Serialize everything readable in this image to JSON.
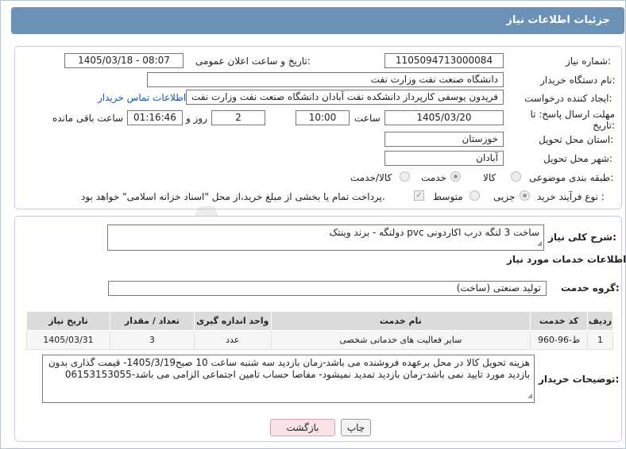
{
  "header": {
    "title": "جزئیات اطلاعات نیاز"
  },
  "form": {
    "need_number_label": "شماره نیاز:",
    "need_number": "1105094713000084",
    "announce_label": "تاریخ و ساعت اعلان عمومی:",
    "announce_value": "1405/03/18 - 08:07",
    "buyer_org_label": "نام دستگاه خریدار:",
    "buyer_org": "دانشگاه صنعت نفت وزارت نفت",
    "creator_label": "ایجاد کننده درخواست:",
    "creator": "فریدون یوسفی کارپرداز دانشکده نفت آبادان دانشگاه صنعت نفت وزارت نفت",
    "contact_link": "اطلاعات تماس خریدار",
    "deadline_label": "مهلت ارسال پاسخ: تا تاریخ:",
    "deadline_date": "1405/03/20",
    "time_label": "ساعت",
    "deadline_time": "10:00",
    "days": "2",
    "days_label": "روز و",
    "remaining_time": "01:16:46",
    "remaining_label": "ساعت باقی مانده",
    "province_label": "استان محل تحویل:",
    "province": "خوزستان",
    "city_label": "شهر محل تحویل:",
    "city": "آبادان",
    "category_label": "طبقه بندی موضوعی:",
    "category_options": [
      "کالا",
      "خدمت",
      "کالا/خدمت"
    ],
    "process_label": "نوع فرآیند خرید :",
    "process_options": [
      "جزیی",
      "متوسط"
    ],
    "treasury_note": "پرداخت تمام یا بخشی از مبلغ خرید،از محل \"اسناد خزانه اسلامی\" خواهد بود."
  },
  "description": {
    "label": "شرح کلی نیاز:",
    "text": "ساخت 3 لنگه  درب اکاردونی pvc دولنگه - برند وینتک"
  },
  "services": {
    "section_title": "اطلاعات خدمات مورد نیاز",
    "group_label": "گروه خدمت:",
    "group_value": "تولید صنعتی (ساخت)",
    "columns": [
      "ردیف",
      "کد خدمت",
      "نام خدمت",
      "واحد اندازه گیری",
      "تعداد / مقدار",
      "تاریخ نیاز"
    ],
    "rows": [
      [
        "1",
        "ط-96-960",
        "سایر فعالیت های خدماتی شخصی",
        "عدد",
        "3",
        "1405/03/31"
      ]
    ]
  },
  "buyer_notes": {
    "label": "توضیحات خریدار:",
    "text": "هزینه تحویل کالا در محل برعهده فروشنده می باشد-زمان بازدید سه شنبه ساعت 10 صبح1405/3/19- قیمت گذاری بدون بازدید مورد تایید نمی باشد-زمان بازدید تمدید نمیشود- مفاصا حساب تامین اجتماعی الزامی می باشد-06153153055"
  },
  "buttons": {
    "print": "چاپ",
    "back": "بازگشت"
  },
  "watermark": "AriaTender.neT",
  "colors": {
    "title_bar": "#6b92b6",
    "link": "#1a56b8",
    "back_button": "#fbe3e8"
  }
}
